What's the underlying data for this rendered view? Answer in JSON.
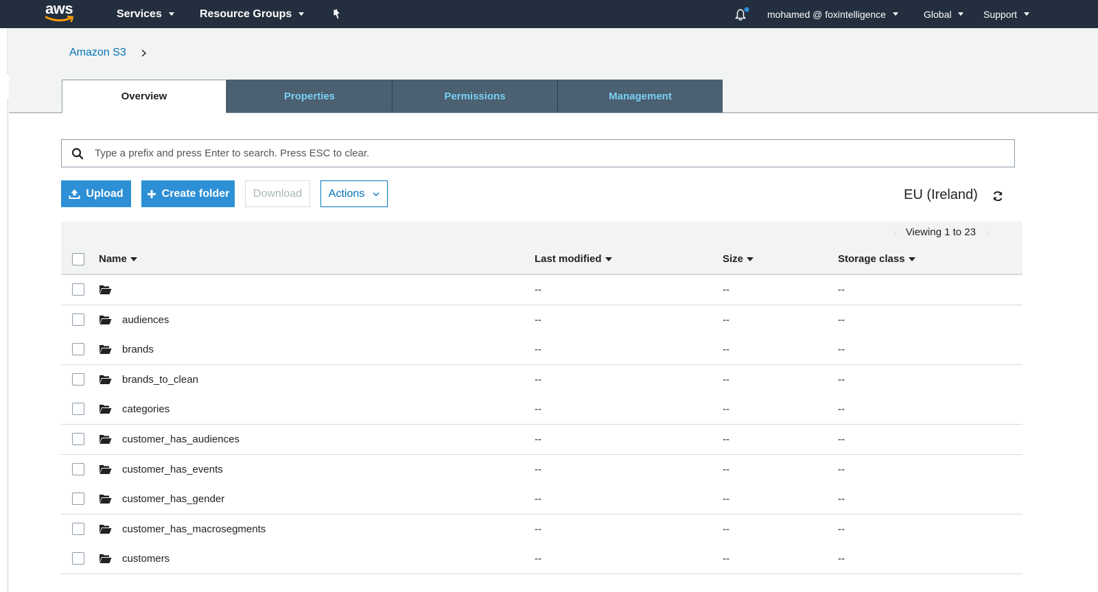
{
  "topnav": {
    "logo_text": "aws",
    "services": "Services",
    "resource_groups": "Resource Groups",
    "account": "mohamed @ foxintelligence",
    "region_menu": "Global",
    "support": "Support"
  },
  "breadcrumb": {
    "root": "Amazon S3"
  },
  "tabs": [
    "Overview",
    "Properties",
    "Permissions",
    "Management"
  ],
  "search": {
    "placeholder": "Type a prefix and press Enter to search. Press ESC to clear."
  },
  "actions": {
    "upload": "Upload",
    "create_folder": "Create folder",
    "download": "Download",
    "actions": "Actions"
  },
  "region": "EU (Ireland)",
  "viewing": "Viewing 1 to 23",
  "columns": {
    "name": "Name",
    "last_modified": "Last modified",
    "size": "Size",
    "storage_class": "Storage class"
  },
  "rows": [
    {
      "name": "",
      "last_modified": "--",
      "size": "--",
      "storage_class": "--"
    },
    {
      "name": "audiences",
      "last_modified": "--",
      "size": "--",
      "storage_class": "--"
    },
    {
      "name": "brands",
      "last_modified": "--",
      "size": "--",
      "storage_class": "--"
    },
    {
      "name": "brands_to_clean",
      "last_modified": "--",
      "size": "--",
      "storage_class": "--"
    },
    {
      "name": "categories",
      "last_modified": "--",
      "size": "--",
      "storage_class": "--"
    },
    {
      "name": "customer_has_audiences",
      "last_modified": "--",
      "size": "--",
      "storage_class": "--"
    },
    {
      "name": "customer_has_events",
      "last_modified": "--",
      "size": "--",
      "storage_class": "--"
    },
    {
      "name": "customer_has_gender",
      "last_modified": "--",
      "size": "--",
      "storage_class": "--"
    },
    {
      "name": "customer_has_macrosegments",
      "last_modified": "--",
      "size": "--",
      "storage_class": "--"
    },
    {
      "name": "customers",
      "last_modified": "--",
      "size": "--",
      "storage_class": "--"
    }
  ],
  "colors": {
    "nav_bg": "#232f3e",
    "link": "#0073bb",
    "primary_button": "#2d8fd5",
    "tab_inactive_bg": "#4b6070",
    "tab_inactive_text": "#7ad1f5",
    "notification_dot": "#2d8fd5"
  }
}
